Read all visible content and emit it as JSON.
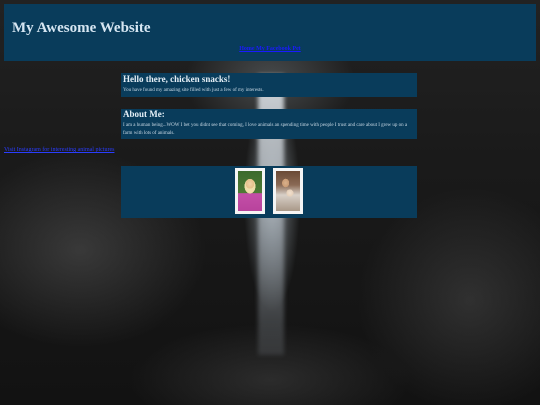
{
  "header": {
    "title": "My Awesome Website",
    "nav_link": "Home My Facebook Pet"
  },
  "side_link": "Visit Instagram for interesting animal pictures",
  "sections": [
    {
      "heading": "Hello there, chicken snacks!",
      "text": "You have found my amazing site filled with just a few of my interests."
    },
    {
      "heading": "About Me:",
      "text": "I am a human being...WOW I bet you didnt see that coming, I love animals an spending time with people I trust and care about I grew up on a farm with lots of animals."
    }
  ],
  "gallery": {
    "photos": [
      {
        "icon": "girl-photo"
      },
      {
        "icon": "family-photo"
      }
    ]
  },
  "colors": {
    "panel": "#093c5b",
    "link": "#1a1aff"
  }
}
